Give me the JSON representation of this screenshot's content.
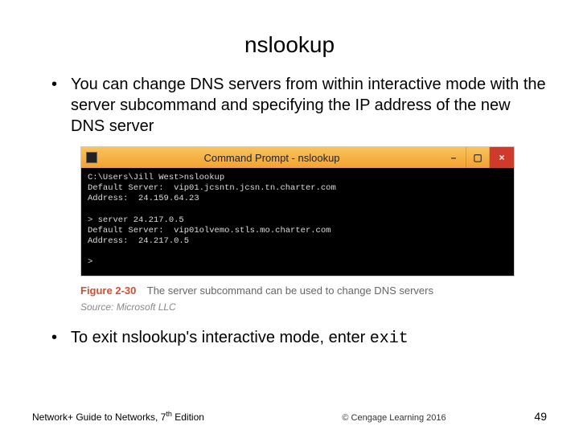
{
  "title": "nslookup",
  "bullet1": "You can change DNS servers from within interactive mode with the server subcommand and specifying the IP address of the new DNS server",
  "cmd": {
    "title": "Command Prompt - nslookup",
    "line1": "C:\\Users\\Jill West>nslookup",
    "line2": "Default Server:  vip01.jcsntn.jcsn.tn.charter.com",
    "line3": "Address:  24.159.64.23",
    "line4": "",
    "line5": "> server 24.217.0.5",
    "line6": "Default Server:  vip01olvemo.stls.mo.charter.com",
    "line7": "Address:  24.217.0.5",
    "line8": "",
    "line9": ">"
  },
  "figure": {
    "label": "Figure 2-30",
    "caption": "The server subcommand can be used to change DNS servers"
  },
  "source": {
    "prefix": "Source:",
    "value": "Microsoft LLC"
  },
  "bullet2_prefix": "To exit nslookup's interactive mode, enter ",
  "bullet2_cmd": "exit",
  "footer": {
    "book_prefix": "Network+ Guide to Networks, 7",
    "book_suffix": " Edition",
    "th": "th",
    "copyright": "© Cengage Learning  2016",
    "page": "49"
  }
}
